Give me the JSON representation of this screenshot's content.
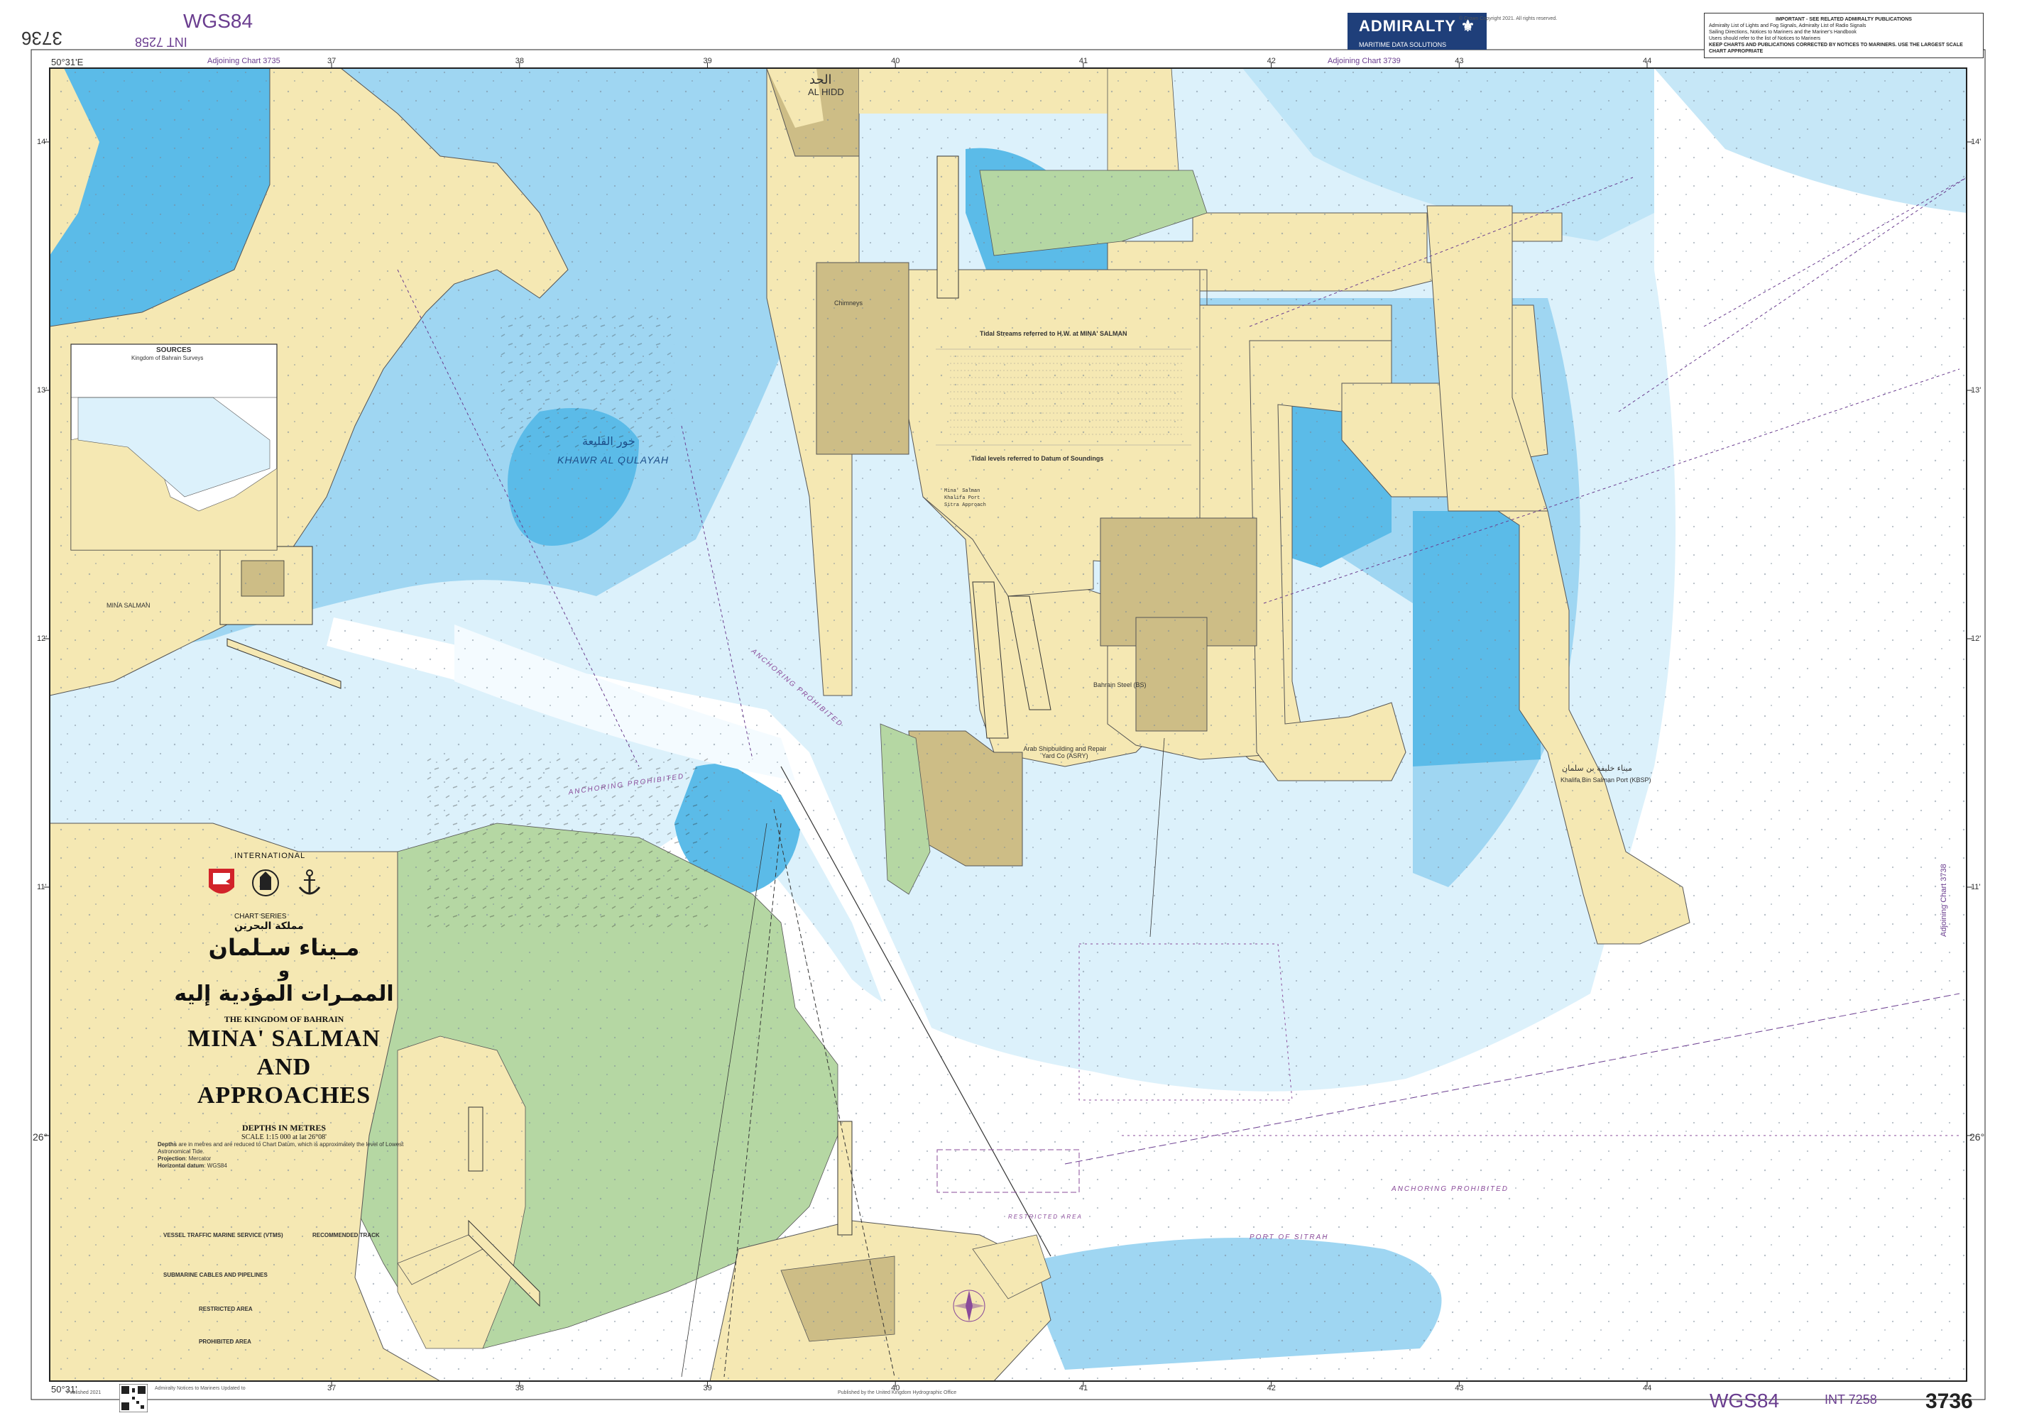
{
  "chart": {
    "number": "3736",
    "number_rotated": "3736",
    "datum_top": "WGS84",
    "datum_bottom": "WGS84",
    "int_top": "INT 7258",
    "int_bottom": "INT 7258",
    "lon_origin": "50°31'E",
    "lat_origin_top": "50°31'",
    "lat_label_26": "26°",
    "lat_ticks_left": [
      "14'",
      "13'",
      "12'",
      "11'",
      "26°"
    ],
    "lat_ticks_right": [
      "14'",
      "13'",
      "12'",
      "11'",
      "26°"
    ],
    "lon_ticks": [
      "37",
      "38",
      "39",
      "40",
      "41",
      "42",
      "43",
      "44"
    ],
    "adjoining_left": "Adjoining Chart 3735",
    "adjoining_top": "Adjoining Chart 3739",
    "adjoining_right": "Adjoining Chart 3738"
  },
  "brand": {
    "name": "ADMIRALTY",
    "sub": "MARITIME DATA SOLUTIONS"
  },
  "notice": {
    "heading": "IMPORTANT - SEE RELATED ADMIRALTY PUBLICATIONS",
    "line1": "Admiralty List of Lights and Fog Signals, Admiralty List of Radio Signals",
    "line2": "Sailing Directions, Notices to Mariners and the Mariner's Handbook",
    "line3": "Users should refer to the list of Notices to Mariners",
    "line4": "KEEP CHARTS AND PUBLICATIONS CORRECTED BY NOTICES TO MARINERS. USE THE LARGEST SCALE CHART APPROPRIATE"
  },
  "copyright": "© Crown Copyright 2021. All rights reserved.",
  "places": {
    "al_hidd_ar": "الحد",
    "al_hidd": "AL HIDD",
    "khawr_ar": "خور القليعة",
    "khawr": "KHAWR AL QULAYAH",
    "mina_salman": "MINA SALMAN",
    "chimneys": "Chimneys",
    "asry": "Arab Shipbuilding and Repair Yard Co (ASRY)",
    "bahrain_steel": "Bahrain Steel (BS)",
    "khalifa_port": "Khalifa Bin Salman Port (KBSP)",
    "khalifa_port_ar": "ميناء خليفة بن سلمان",
    "port_of_sitrah": "PORT OF SITRAH",
    "anchoring_prohibited": "ANCHORING PROHIBITED",
    "restricted_area": "RESTRICTED AREA",
    "sources_title": "SOURCES",
    "sources_sub": "Kingdom of Bahrain Surveys"
  },
  "tidal": {
    "streams_title": "Tidal Streams referred to H.W. at MINA' SALMAN",
    "levels_title": "Tidal levels referred to Datum of Soundings",
    "levels_rows": [
      "Mina' Salman",
      "Khalifa Port",
      "Sitra Approach"
    ]
  },
  "title": {
    "international": "INTERNATIONAL",
    "chart_series": "CHART SERIES",
    "kingdom_ar": "مملكة البحرين",
    "arabic_line1": "مـيناء سـلمان",
    "arabic_and": "و",
    "arabic_line2": "الممـرات المؤدية إليه",
    "kingdom": "THE KINGDOM OF BAHRAIN",
    "line1": "MINA' SALMAN",
    "line2": "AND",
    "line3": "APPROACHES",
    "depths": "DEPTHS IN METRES",
    "scale": "SCALE 1:15 000 at lat 26°08'"
  },
  "notes": {
    "heights_label": "Depths",
    "heights_text": "are in metres and are reduced to Chart Datum, which is approximately the level of Lowest Astronomical Tide.",
    "projection_label": "Projection",
    "projection": "Mercator",
    "horizontal_label": "Horizontal datum",
    "horizontal": "WGS84",
    "vts_title": "VESSEL TRAFFIC MARINE SERVICE (VTMS)",
    "cables_title": "SUBMARINE CABLES AND PIPELINES",
    "restricted_title": "RESTRICTED AREA",
    "prohibited_title": "PROHIBITED AREA",
    "recommended_title": "RECOMMENDED TRACK"
  },
  "footer": {
    "edition": "Published 2021",
    "left_note": "Admiralty Notices to Mariners Updated to",
    "publisher": "Published by the United Kingdom Hydrographic Office"
  },
  "colors": {
    "land": "#f5e8b3",
    "land_green": "#b5d7a3",
    "reclaim": "#cdbd86",
    "shallow": "#5bbbe8",
    "medium": "#9fd6f2",
    "deep": "#dcf1fb",
    "dredged": "#ffffff",
    "purple": "#8a4b9a",
    "admiralty_blue": "#1f3f7a"
  },
  "icons": [
    "bahrain-crest-icon",
    "admiralty-crest-icon",
    "anchor-crest-icon",
    "qr-code-icon",
    "compass-rose-icon"
  ]
}
